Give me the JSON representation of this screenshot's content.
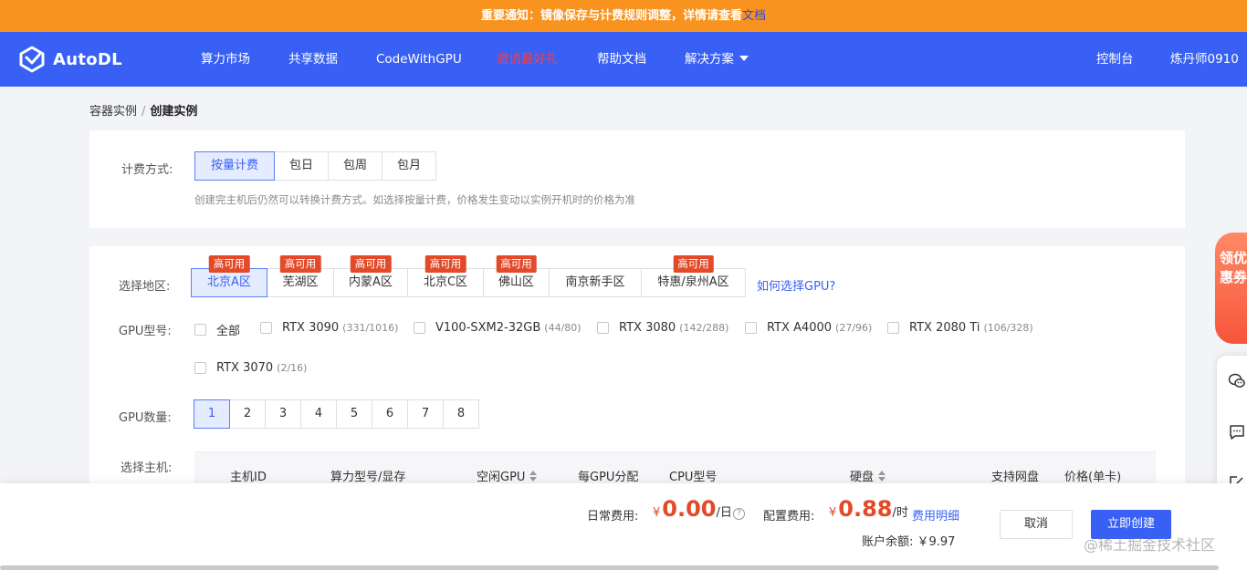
{
  "notice": {
    "text": "重要通知：镜像保存与计费规则调整，详情请查看",
    "link": "文档"
  },
  "nav": {
    "brand": "AutoDL",
    "items": [
      "算力市场",
      "共享数据",
      "CodeWithGPU",
      "邀请最好礼",
      "帮助文档",
      "解决方案"
    ],
    "console": "控制台",
    "user": "炼丹师0910"
  },
  "breadcrumb": {
    "parent": "容器实例",
    "separator": "/",
    "current": "创建实例"
  },
  "billing": {
    "label": "计费方式:",
    "options": [
      "按量计费",
      "包日",
      "包周",
      "包月"
    ],
    "selected": "按量计费",
    "hint": "创建完主机后仍然可以转换计费方式。如选择按量计费，价格发生变动以实例开机时的价格为准"
  },
  "region": {
    "label": "选择地区:",
    "options": [
      {
        "name": "北京A区",
        "badge": "高可用"
      },
      {
        "name": "芜湖区",
        "badge": "高可用"
      },
      {
        "name": "内蒙A区",
        "badge": "高可用"
      },
      {
        "name": "北京C区",
        "badge": "高可用"
      },
      {
        "name": "佛山区",
        "badge": "高可用"
      },
      {
        "name": "南京新手区",
        "badge": ""
      },
      {
        "name": "特惠/泉州A区",
        "badge": "高可用"
      }
    ],
    "selected": "北京A区",
    "help_link": "如何选择GPU?"
  },
  "gpu_model": {
    "label": "GPU型号:",
    "options": [
      {
        "name": "全部",
        "count": ""
      },
      {
        "name": "RTX 3090",
        "count": "(331/1016)"
      },
      {
        "name": "V100-SXM2-32GB",
        "count": "(44/80)"
      },
      {
        "name": "RTX 3080",
        "count": "(142/288)"
      },
      {
        "name": "RTX A4000",
        "count": "(27/96)"
      },
      {
        "name": "RTX 2080 Ti",
        "count": "(106/328)"
      },
      {
        "name": "RTX 3070",
        "count": "(2/16)"
      }
    ]
  },
  "gpu_count": {
    "label": "GPU数量:",
    "options": [
      "1",
      "2",
      "3",
      "4",
      "5",
      "6",
      "7",
      "8"
    ],
    "selected": "1"
  },
  "host": {
    "label": "选择主机:",
    "columns": [
      "主机ID",
      "算力型号/显存",
      "空闲GPU",
      "每GPU分配",
      "CPU型号",
      "硬盘",
      "支持网盘",
      "价格(单卡)"
    ]
  },
  "footer": {
    "daily_label": "日常费用:",
    "daily_currency": "¥",
    "daily_value": "0.00",
    "daily_unit": "/日",
    "config_label": "配置费用:",
    "config_currency": "¥",
    "config_value": "0.88",
    "config_unit": "/时",
    "detail_link": "费用明细",
    "balance": "账户余额: ￥9.97",
    "cancel": "取消",
    "create": "立即创建",
    "watermark": "@稀土掘金技术社区"
  },
  "side": {
    "coupon": "领优惠券"
  },
  "colors": {
    "primary": "#3860f4",
    "notice": "#f7931e",
    "price": "#e24a2a"
  }
}
